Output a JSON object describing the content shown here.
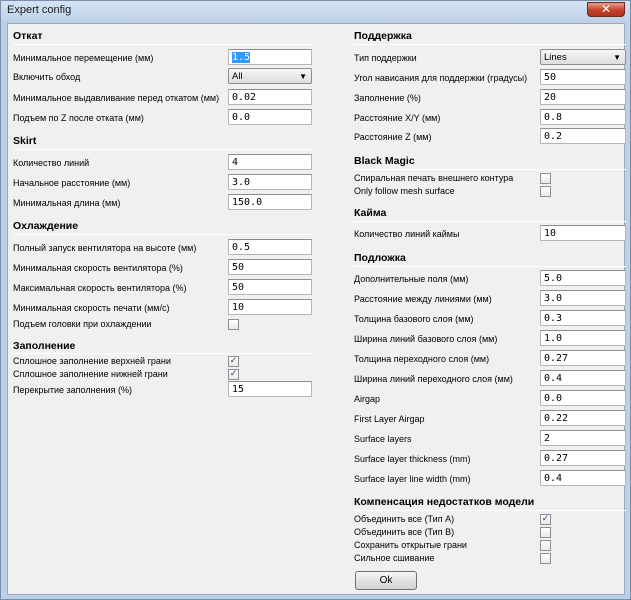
{
  "window": {
    "title": "Expert config",
    "close_glyph": "✕"
  },
  "checkmark": "✓",
  "left": {
    "retraction": {
      "title": "Откат",
      "rows": [
        {
          "label": "Минимальное перемещение (мм)",
          "value": "1.5"
        },
        {
          "label": "Включить обход",
          "value": "All"
        },
        {
          "label": "Минимальное выдавливание перед откатом (мм)",
          "value": "0.02"
        },
        {
          "label": "Подъем по Z после отката (мм)",
          "value": "0.0"
        }
      ]
    },
    "skirt": {
      "title": "Skirt",
      "rows": [
        {
          "label": "Количество линий",
          "value": "4"
        },
        {
          "label": "Начальное расстояние (мм)",
          "value": "3.0"
        },
        {
          "label": "Минимальная длина (мм)",
          "value": "150.0"
        }
      ]
    },
    "cool": {
      "title": "Охлаждение",
      "rows": [
        {
          "label": "Полный запуск вентилятора на высоте (мм)",
          "value": "0.5"
        },
        {
          "label": "Минимальная скорость вентилятора (%)",
          "value": "50"
        },
        {
          "label": "Максимальная скорость вентилятора (%)",
          "value": "50"
        },
        {
          "label": "Минимальная скорость печати (мм/с)",
          "value": "10"
        },
        {
          "label": "Подъем головки при охлаждении",
          "checked": false
        }
      ]
    },
    "infill": {
      "title": "Заполнение",
      "rows": [
        {
          "label": "Сплошное заполнение верхней грани",
          "checked": true
        },
        {
          "label": "Сплошное заполнение нижней грани",
          "checked": true
        },
        {
          "label": "Перекрытие заполнения (%)",
          "value": "15"
        }
      ]
    }
  },
  "right": {
    "support": {
      "title": "Поддержка",
      "rows": [
        {
          "label": "Тип поддержки",
          "value": "Lines"
        },
        {
          "label": "Угол нависания для поддержки (градусы)",
          "value": "50"
        },
        {
          "label": "Заполнение (%)",
          "value": "20"
        },
        {
          "label": "Расстояние X/Y (мм)",
          "value": "0.8"
        },
        {
          "label": "Расстояние Z (мм)",
          "value": "0.2"
        }
      ]
    },
    "black_magic": {
      "title": "Black Magic",
      "rows": [
        {
          "label": "Спиральная печать внешнего контура",
          "checked": false
        },
        {
          "label": "Only follow mesh surface",
          "checked": false
        }
      ]
    },
    "brim": {
      "title": "Кайма",
      "rows": [
        {
          "label": "Количество линий каймы",
          "value": "10"
        }
      ]
    },
    "raft": {
      "title": "Подложка",
      "rows": [
        {
          "label": "Дополнительные поля (мм)",
          "value": "5.0"
        },
        {
          "label": "Расстояние между линиями (мм)",
          "value": "3.0"
        },
        {
          "label": "Толщина базового слоя (мм)",
          "value": "0.3"
        },
        {
          "label": "Ширина линий базового слоя (мм)",
          "value": "1.0"
        },
        {
          "label": "Толщина переходного слоя (мм)",
          "value": "0.27"
        },
        {
          "label": "Ширина линий переходного слоя (мм)",
          "value": "0.4"
        },
        {
          "label": "Airgap",
          "value": "0.0"
        },
        {
          "label": "First Layer Airgap",
          "value": "0.22"
        },
        {
          "label": "Surface layers",
          "value": "2"
        },
        {
          "label": "Surface layer thickness (mm)",
          "value": "0.27"
        },
        {
          "label": "Surface layer line width (mm)",
          "value": "0.4"
        }
      ]
    },
    "fix": {
      "title": "Компенсация недостатков модели",
      "rows": [
        {
          "label": "Объединить все (Тип А)",
          "checked": true
        },
        {
          "label": "Объединить все (Тип В)",
          "checked": false
        },
        {
          "label": "Сохранить открытые грани",
          "checked": false
        },
        {
          "label": "Сильное сшивание",
          "checked": false
        }
      ]
    }
  },
  "ok_label": "Ok"
}
